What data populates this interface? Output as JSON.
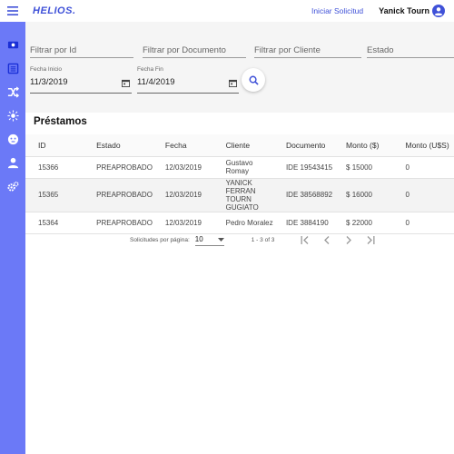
{
  "header": {
    "logo": "HELIOS.",
    "request_link": "Iniciar Solicitud",
    "username": "Yanick Tourn"
  },
  "sidebar": {
    "items": [
      {
        "icon": "money-icon"
      },
      {
        "icon": "list-icon"
      },
      {
        "icon": "shuffle-icon"
      },
      {
        "icon": "sun-icon"
      },
      {
        "icon": "face-icon"
      },
      {
        "icon": "person-icon"
      },
      {
        "icon": "settings-icon"
      }
    ]
  },
  "filters": {
    "id_placeholder": "Filtrar por Id",
    "document_placeholder": "Filtrar por Documento",
    "client_placeholder": "Filtrar por Cliente",
    "status_placeholder": "Estado",
    "start_label": "Fecha Inicio",
    "start_value": "11/3/2019",
    "end_label": "Fecha Fin",
    "end_value": "11/4/2019"
  },
  "table": {
    "title": "Préstamos",
    "columns": [
      "ID",
      "Estado",
      "Fecha",
      "Cliente",
      "Documento",
      "Monto ($)",
      "Monto (U$S)"
    ],
    "rows": [
      [
        "15366",
        "PREAPROBADO",
        "12/03/2019",
        "Gustavo Romay",
        "IDE 19543415",
        "$ 15000",
        "0"
      ],
      [
        "15365",
        "PREAPROBADO",
        "12/03/2019",
        "YANICK FERRAN TOURN GUGIATO",
        "IDE 38568892",
        "$ 16000",
        "0"
      ],
      [
        "15364",
        "PREAPROBADO",
        "12/03/2019",
        "Pedro Moralez",
        "IDE 3884190",
        "$ 22000",
        "0"
      ]
    ]
  },
  "pagination": {
    "per_page_label": "Solicitudes por página:",
    "per_page_value": "10",
    "range": "1 - 3 of 3"
  },
  "colors": {
    "accent": "#3f51d8",
    "sidebar": "#6b79f7"
  }
}
